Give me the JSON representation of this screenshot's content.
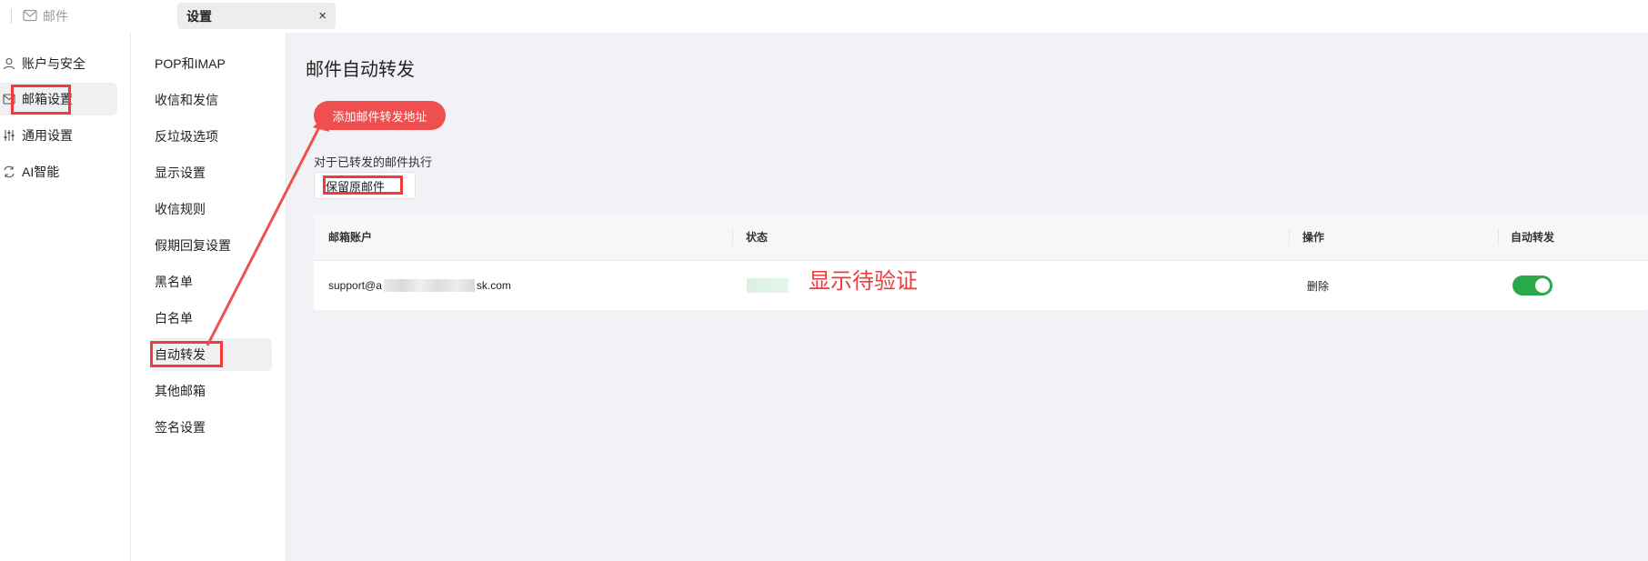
{
  "top_tabs": {
    "mail_label": "邮件",
    "settings_label": "设置",
    "close_glyph": "×"
  },
  "sidebar_main": {
    "items": [
      {
        "label": "账户与安全",
        "icon": "user-icon"
      },
      {
        "label": "邮箱设置",
        "icon": "mail-icon"
      },
      {
        "label": "通用设置",
        "icon": "sliders-icon"
      },
      {
        "label": "AI智能",
        "icon": "ai-refresh-icon"
      }
    ],
    "active_index": 1
  },
  "sidebar_sub": {
    "items": [
      "POP和IMAP",
      "收信和发信",
      "反垃圾选项",
      "显示设置",
      "收信规则",
      "假期回复设置",
      "黑名单",
      "白名单",
      "自动转发",
      "其他邮箱",
      "签名设置"
    ],
    "active_index": 8
  },
  "main": {
    "page_title": "邮件自动转发",
    "add_button_label": "添加邮件转发地址",
    "exec_label": "对于已转发的邮件执行",
    "keep_mail_value": "保留原邮件",
    "table": {
      "headers": [
        "邮箱账户",
        "状态",
        "操作",
        "自动转发"
      ],
      "rows": [
        {
          "account_prefix": "support@a",
          "account_suffix": "sk.com",
          "action": "删除",
          "auto_forward_on": true
        }
      ]
    },
    "annotation_text": "显示待验证"
  },
  "colors": {
    "annotation_red": "#ef3b3b",
    "add_button_red": "#ef4f4f",
    "toggle_green": "#2aa84a",
    "content_bg": "#f2f2f6"
  }
}
